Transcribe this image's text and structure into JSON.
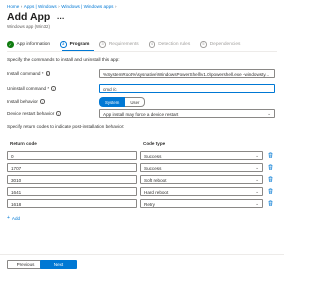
{
  "breadcrumb": [
    {
      "label": "Home"
    },
    {
      "label": "Apps | Windows"
    },
    {
      "label": "Windows | Windows apps"
    }
  ],
  "page": {
    "title": "Add App",
    "title_more": "...",
    "subtitle": "Windows app (Win32)"
  },
  "steps": [
    {
      "label": "App information",
      "glyph": "✓",
      "state": "done"
    },
    {
      "label": "Program",
      "glyph": "2",
      "state": "active"
    },
    {
      "label": "Requirements",
      "glyph": "3",
      "state": "future"
    },
    {
      "label": "Detection rules",
      "glyph": "4",
      "state": "future"
    },
    {
      "label": "Dependencies",
      "glyph": "5",
      "state": "future"
    }
  ],
  "form": {
    "intro": "Specify the commands to install and uninstall this app:",
    "install_label": "Install command *",
    "install_value": "%SystemRoot%\\sysnative\\WindowsPowerShell\\v1.0\\powershell.exe -windowsty...",
    "uninstall_label": "Uninstall command *",
    "uninstall_value": "cmd /c",
    "behavior_label": "Install behavior",
    "behavior_options": [
      "System",
      "User"
    ],
    "restart_label": "Device restart behavior",
    "restart_value": "App install may force a device restart"
  },
  "return_codes": {
    "intro": "Specify return codes to indicate post-installation behavior:",
    "col_code": "Return code",
    "col_type": "Code type",
    "rows": [
      {
        "code": "0",
        "type": "Success"
      },
      {
        "code": "1707",
        "type": "Success"
      },
      {
        "code": "3010",
        "type": "Soft reboot"
      },
      {
        "code": "1641",
        "type": "Hard reboot"
      },
      {
        "code": "1618",
        "type": "Retry"
      }
    ],
    "add_label": "Add"
  },
  "footer": {
    "previous": "Previous",
    "next": "Next"
  },
  "colors": {
    "accent": "#0078d4",
    "success": "#107c10",
    "required": "#a4262c"
  },
  "icons": {
    "info": "info-icon",
    "delete": "trash-icon",
    "chevron": "chevron-down-icon",
    "add": "plus-icon"
  }
}
